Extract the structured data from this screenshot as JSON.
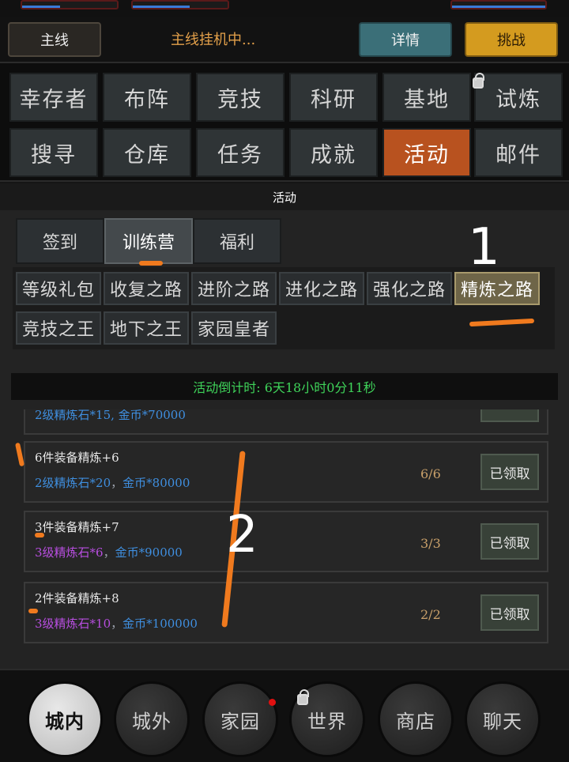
{
  "header": {
    "main_line_label": "主线",
    "status_text": "主线挂机中...",
    "details_label": "详情",
    "challenge_label": "挑战"
  },
  "nav": {
    "row1": [
      "幸存者",
      "布阵",
      "竞技",
      "科研",
      "基地",
      "试炼"
    ],
    "row2": [
      "搜寻",
      "仓库",
      "任务",
      "成就",
      "活动",
      "邮件"
    ],
    "active": "活动"
  },
  "activity": {
    "title": "活动",
    "tabs": [
      "签到",
      "训练营",
      "福利"
    ],
    "active_tab": "训练营",
    "sub_row1": [
      "等级礼包",
      "收复之路",
      "进阶之路",
      "进化之路",
      "强化之路",
      "精炼之路"
    ],
    "sub_row2": [
      "竞技之王",
      "地下之王",
      "家园皇者"
    ],
    "active_sub": "精炼之路",
    "countdown": "活动倒计时: 6天18小时0分11秒"
  },
  "list": {
    "partial": {
      "reward": "2级精炼石*15, 金币*70000"
    },
    "items": [
      {
        "task": "6件装备精炼+6",
        "reward_stone": "2级精炼石*20",
        "reward_coin": "金币*80000",
        "progress": "6/6",
        "button": "已领取",
        "stone_color": "#3f8fe0"
      },
      {
        "task": "3件装备精炼+7",
        "reward_stone": "3级精炼石*6",
        "reward_coin": "金币*90000",
        "progress": "3/3",
        "button": "已领取",
        "stone_color": "#b84ee0"
      },
      {
        "task": "2件装备精炼+8",
        "reward_stone": "3级精炼石*10",
        "reward_coin": "金币*100000",
        "progress": "2/2",
        "button": "已领取",
        "stone_color": "#b84ee0"
      }
    ]
  },
  "bottom_nav": [
    "城内",
    "城外",
    "家园",
    "世界",
    "商店",
    "聊天"
  ],
  "bottom_active": "城内",
  "annotations": {
    "one": "1",
    "two": "2"
  },
  "colors": {
    "accent_orange": "#f07a1e",
    "active_tab": "#b8521f",
    "countdown_green": "#3fd45a"
  }
}
